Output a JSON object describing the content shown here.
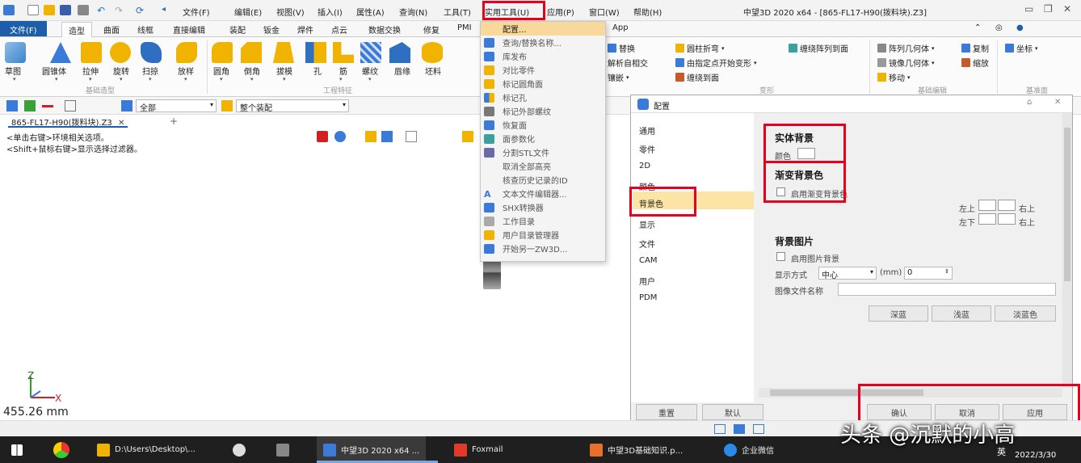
{
  "menubar": {
    "items": [
      "文件(F)",
      "编辑(E)",
      "视图(V)",
      "插入(I)",
      "属性(A)",
      "查询(N)",
      "工具(T)",
      "实用工具(U)",
      "应用(P)",
      "窗口(W)",
      "帮助(H)"
    ],
    "window_title": "中望3D 2020 x64 - [865-FL17-H90(拨料块).Z3]"
  },
  "ribbon_tabs": {
    "file": "文件(F)",
    "tabs": [
      "造型",
      "曲面",
      "线框",
      "直接编辑",
      "装配",
      "钣金",
      "焊件",
      "点云",
      "数据交换",
      "修复",
      "PMI"
    ],
    "app": "App"
  },
  "ribbon": {
    "basic_tools": [
      "草图",
      "圆锥体",
      "拉伸",
      "旋转",
      "扫掠",
      "放样"
    ],
    "basic_group": "基础造型",
    "eng_tools": [
      "圆角",
      "倒角",
      "拔模",
      "孔",
      "筋",
      "螺纹",
      "唇缘",
      "坯料"
    ],
    "eng_group": "工程特征",
    "edit_col1": [
      "替换",
      "解析自相交",
      "镶嵌"
    ],
    "morph_col1": [
      "圆柱折弯",
      "由指定点开始变形",
      "缠绕到面"
    ],
    "morph_col2": [
      "缠绕阵列到面"
    ],
    "morph_group": "变形",
    "basic_edit": [
      "阵列几何体",
      "镜像几何体",
      "移动",
      "复制",
      "缩放"
    ],
    "basic_edit_group": "基础编辑",
    "datum": [
      "坐标"
    ],
    "datum_group": "基准面"
  },
  "cmdbar": {
    "filter_value": "全部",
    "select_value": "整个装配"
  },
  "document": {
    "tab": "865-FL17-H90(拨料块).Z3",
    "hint1": "<单击右键>环境相关选项。",
    "hint2": "<Shift+鼠标右键>显示选择过滤器。",
    "coordinate": "455.26 mm",
    "axis_z": "Z",
    "axis_x": "X"
  },
  "dropdown": {
    "items": [
      "配置...",
      "查询/替换名称...",
      "库发布",
      "对比零件",
      "标记圆角面",
      "标记孔",
      "标记外部螺纹",
      "恢复面",
      "面参数化",
      "分割STL文件",
      "取消全部高亮",
      "核查历史记录的ID",
      "文本文件编辑器...",
      "SHX转换器",
      "工作目录",
      "用户目录管理器",
      "开始另一ZW3D..."
    ]
  },
  "dialog": {
    "title": "配置",
    "nav": [
      "通用",
      "零件",
      "2D",
      "颜色",
      "背景色",
      "显示",
      "文件",
      "CAM",
      "用户",
      "PDM"
    ],
    "solid_bg_title": "实体背景",
    "color_label": "颜色",
    "gradient_title": "渐变背景色",
    "enable_gradient": "启用渐变背景色",
    "top_left": "左上",
    "top_right": "右上",
    "bottom_left": "左下",
    "bottom_right": "右上",
    "bg_image_title": "背景图片",
    "enable_image": "启用图片背景",
    "display_mode_label": "显示方式",
    "display_mode_value": "中心",
    "unit_label": "(mm)",
    "unit_value": "0",
    "image_file_label": "图像文件名称",
    "preset_buttons": [
      "深蓝",
      "浅蓝",
      "淡蓝色"
    ],
    "bottom_left_buttons": [
      "重置",
      "默认"
    ],
    "bottom_right_buttons": [
      "确认",
      "取消",
      "应用"
    ]
  },
  "taskbar": {
    "items": [
      "D:\\Users\\Desktop\\...",
      "中望3D 2020 x64 ...",
      "Foxmail",
      "中望3D基础知识.p...",
      "企业微信"
    ],
    "ime": "英",
    "date": "2022/3/30",
    "watermark": "头条 @沉默的小高"
  }
}
